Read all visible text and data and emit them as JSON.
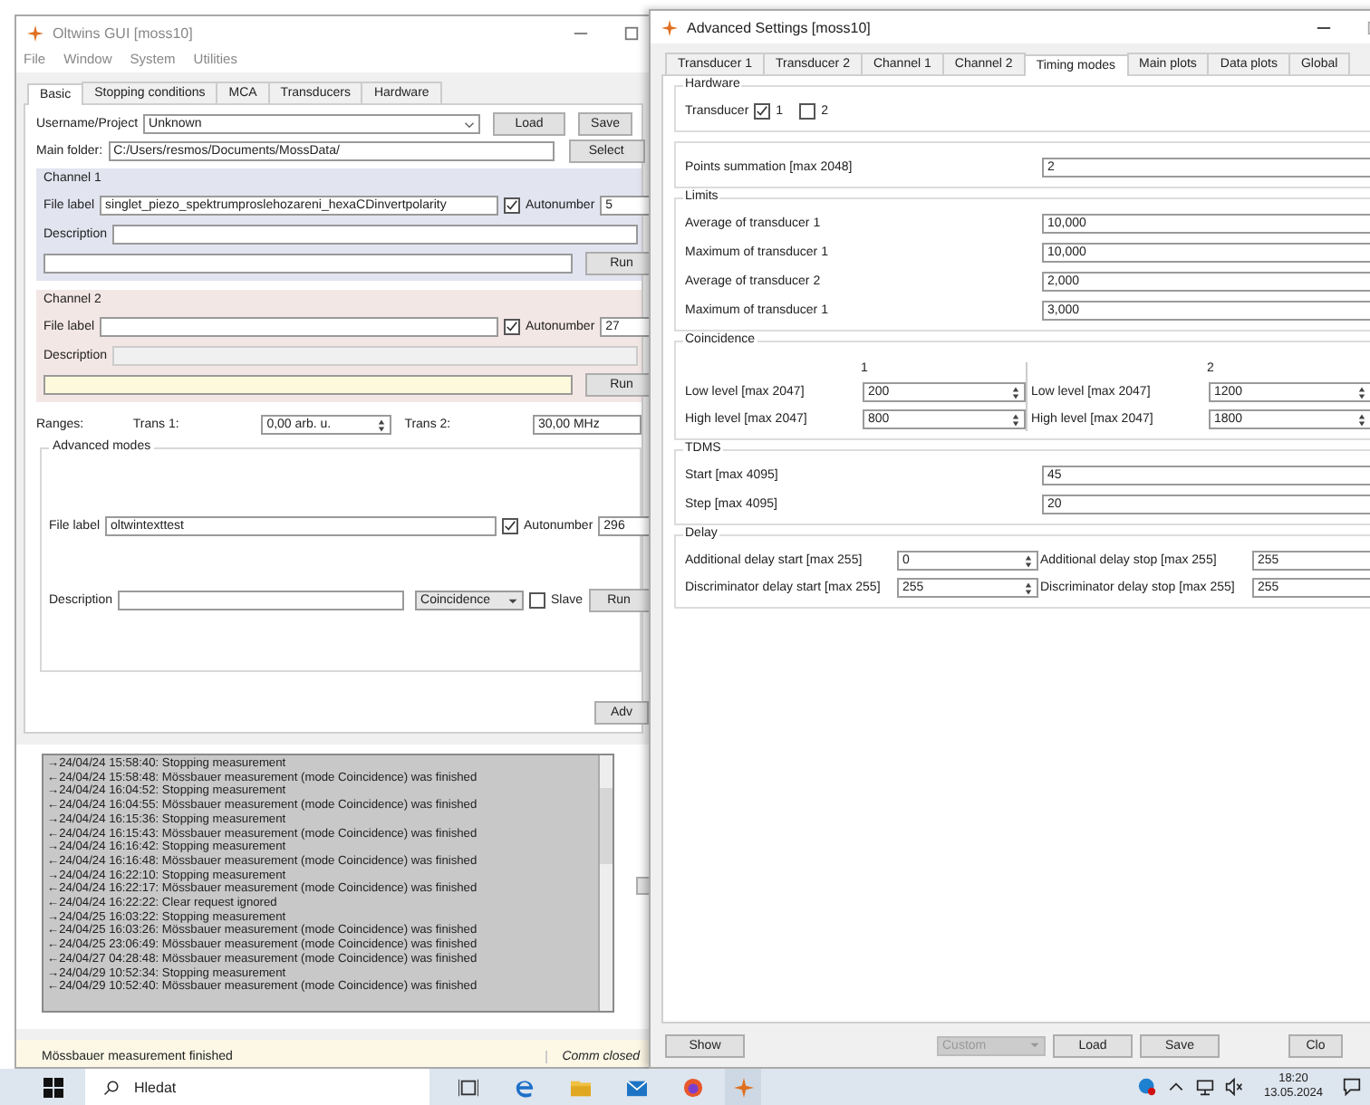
{
  "left_window": {
    "title": "Oltwins GUI [moss10]",
    "menu": [
      "File",
      "Window",
      "System",
      "Utilities"
    ],
    "tabs": [
      {
        "label": "Basic",
        "selected": true
      },
      {
        "label": "Stopping conditions",
        "selected": false
      },
      {
        "label": "MCA",
        "selected": false
      },
      {
        "label": "Transducers",
        "selected": false
      },
      {
        "label": "Hardware",
        "selected": false
      }
    ],
    "username_label": "Username/Project",
    "username_value": "Unknown",
    "load_button": "Load",
    "save_button": "Save",
    "main_folder_label": "Main folder:",
    "main_folder_value": "C:/Users/resmos/Documents/MossData/",
    "select_button": "Select",
    "channels": [
      {
        "title": "Channel 1",
        "color": "#e2e4f0",
        "file_label": "File label",
        "file_value": "singlet_piezo_spektrumproslehozareni_hexaCDinvertpolarity",
        "autonumber_label": "Autonumber",
        "autonumber": true,
        "autonumber_value": "5",
        "description_label": "Description",
        "description_disabled": false,
        "status_highlighted": false,
        "run_button": "Run"
      },
      {
        "title": "Channel 2",
        "color": "#f3e7e5",
        "file_label": "File label",
        "autonumber_label": "Autonumber",
        "autonumber": true,
        "autonumber_value": "27",
        "description_label": "Description",
        "description_disabled": true,
        "status_highlighted": true,
        "run_button": "Run"
      }
    ],
    "ranges": {
      "label": "Ranges:",
      "trans1_label": "Trans 1:",
      "trans1_value": "0,00 arb. u.",
      "trans2_label": "Trans 2:",
      "trans2_value": "30,00 MHz"
    },
    "advanced_modes": {
      "title": "Advanced modes",
      "file_label": "File label",
      "file_value": "oltwintexttest",
      "autonumber_label": "Autonumber",
      "autonumber": true,
      "autonumber_value": "296",
      "description_label": "Description",
      "mode": "Coincidence",
      "slave_label": "Slave",
      "slave": false,
      "run_button": "Run"
    },
    "advanced_button": "Adv",
    "log": [
      "→24/04/24 15:58:40: Stopping measurement",
      "←24/04/24 15:58:48: Mössbauer measurement (mode Coincidence) was finished",
      "→24/04/24 16:04:52: Stopping measurement",
      "←24/04/24 16:04:55: Mössbauer measurement (mode Coincidence) was finished",
      "→24/04/24 16:15:36: Stopping measurement",
      "←24/04/24 16:15:43: Mössbauer measurement (mode Coincidence) was finished",
      "→24/04/24 16:16:42: Stopping measurement",
      "←24/04/24 16:16:48: Mössbauer measurement (mode Coincidence) was finished",
      "→24/04/24 16:22:10: Stopping measurement",
      "←24/04/24 16:22:17: Mössbauer measurement (mode Coincidence) was finished",
      "←24/04/24 16:22:22: Clear request ignored",
      "→24/04/25 16:03:22: Stopping measurement",
      "←24/04/25 16:03:26: Mössbauer measurement (mode Coincidence) was finished",
      "←24/04/25 23:06:49: Mössbauer measurement (mode Coincidence) was finished",
      "←24/04/27 04:28:48: Mössbauer measurement (mode Coincidence) was finished",
      "→24/04/29 10:52:34: Stopping measurement",
      "←24/04/29 10:52:40: Mössbauer measurement (mode Coincidence) was finished"
    ],
    "status_message": "Mössbauer measurement finished",
    "connection_status": "Comm closed"
  },
  "right_window": {
    "title": "Advanced Settings [moss10]",
    "tabs": [
      {
        "label": "Transducer 1",
        "selected": false
      },
      {
        "label": "Transducer 2",
        "selected": false
      },
      {
        "label": "Channel 1",
        "selected": false
      },
      {
        "label": "Channel 2",
        "selected": false
      },
      {
        "label": "Timing modes",
        "selected": true
      },
      {
        "label": "Main plots",
        "selected": false
      },
      {
        "label": "Data plots",
        "selected": false
      },
      {
        "label": "Global",
        "selected": false
      }
    ],
    "hardware": {
      "title": "Hardware",
      "label": "Transducer",
      "options": [
        {
          "label": "1",
          "checked": true
        },
        {
          "label": "2",
          "checked": false
        }
      ]
    },
    "points": {
      "label": "Points summation [max 2048]",
      "value": "2"
    },
    "limits": {
      "title": "Limits",
      "rows": [
        {
          "label": "Average of transducer 1",
          "value": "10,000"
        },
        {
          "label": "Maximum of transducer 1",
          "value": "10,000"
        },
        {
          "label": "Average of transducer 2",
          "value": "2,000"
        },
        {
          "label": "Maximum of transducer 1",
          "value": "3,000"
        }
      ]
    },
    "coincidence": {
      "title": "Coincidence",
      "columns": [
        {
          "header": "1",
          "rows": [
            {
              "label": "Low level [max 2047]",
              "value": "200"
            },
            {
              "label": "High level [max 2047]",
              "value": "800"
            }
          ]
        },
        {
          "header": "2",
          "rows": [
            {
              "label": "Low level [max 2047]",
              "value": "1200"
            },
            {
              "label": "High level [max 2047]",
              "value": "1800"
            }
          ]
        }
      ]
    },
    "tdms": {
      "title": "TDMS",
      "rows": [
        {
          "label": "Start [max 4095]",
          "value": "45"
        },
        {
          "label": "Step [max 4095]",
          "value": "20"
        }
      ]
    },
    "delay": {
      "title": "Delay",
      "rows": [
        {
          "label": "Additional delay start [max 255]",
          "value": "0"
        },
        {
          "label": "Additional delay stop [max 255]",
          "value": "255"
        },
        {
          "label": "Discriminator delay start [max 255]",
          "value": "255"
        },
        {
          "label": "Discriminator delay stop [max 255]",
          "value": "255"
        }
      ]
    },
    "show_button": "Show",
    "preset": "Custom",
    "preset_disabled": true,
    "load_button": "Load",
    "save_button": "Save",
    "close_button": "Clo"
  },
  "taskbar": {
    "search_placeholder": "Hledat",
    "time": "18:20",
    "date": "13.05.2024"
  }
}
